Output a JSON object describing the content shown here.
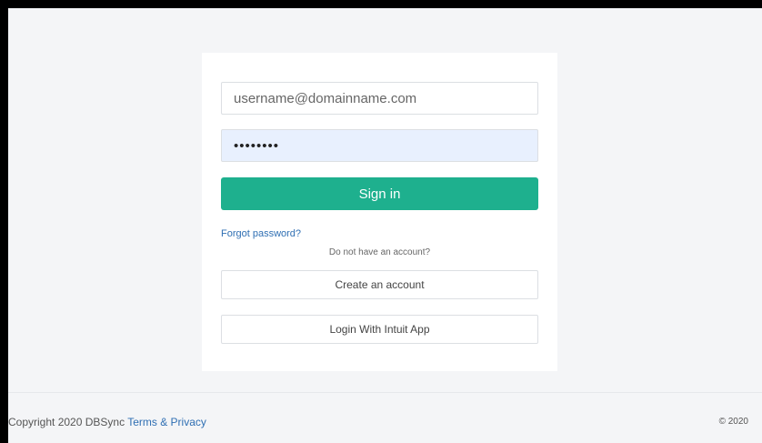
{
  "login": {
    "email_placeholder": "username@domainname.com",
    "password_value": "••••••••",
    "sign_in_label": "Sign in",
    "forgot_password_label": "Forgot password?",
    "no_account_text": "Do not have an account?",
    "create_account_label": "Create an account",
    "intuit_login_label": "Login With Intuit App"
  },
  "footer": {
    "copyright_text": "Copyright 2020 DBSync",
    "terms_link_label": "Terms & Privacy",
    "right_text": "© 2020"
  },
  "colors": {
    "primary_button": "#1eb08e",
    "link": "#2f6fb3",
    "autofill_background": "#e8f0fe",
    "page_background": "#f4f5f7"
  }
}
